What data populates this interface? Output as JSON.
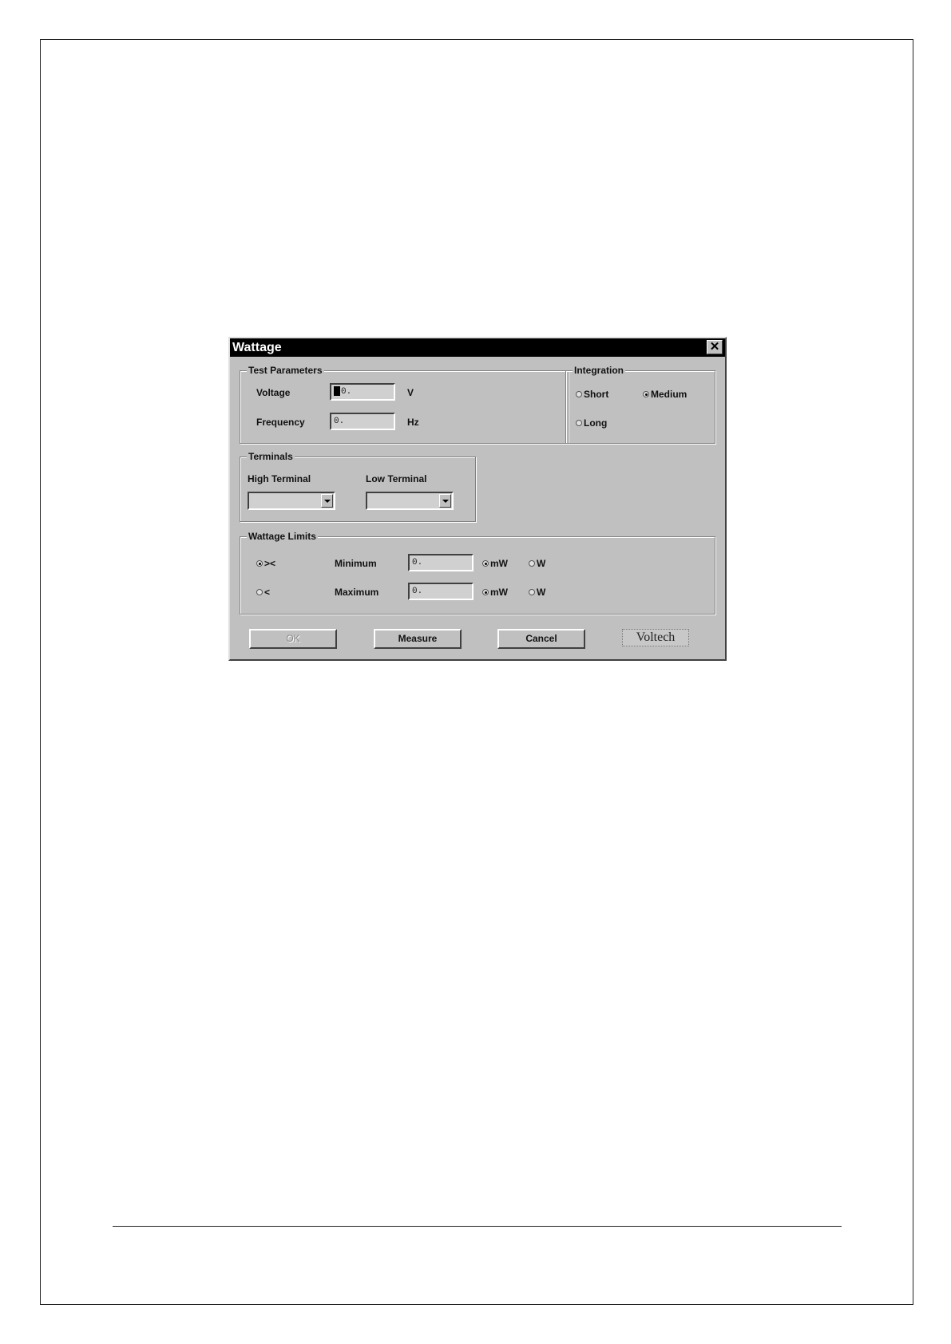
{
  "dialog": {
    "title": "Wattage",
    "close_glyph": "✕"
  },
  "test_parameters": {
    "legend": "Test Parameters",
    "voltage_label": "Voltage",
    "voltage_value": "0.",
    "voltage_unit": "V",
    "frequency_label": "Frequency",
    "frequency_value": "0.",
    "frequency_unit": "Hz"
  },
  "integration": {
    "legend": "Integration",
    "options": [
      {
        "label": "Short",
        "selected": false
      },
      {
        "label": "Medium",
        "selected": true
      },
      {
        "label": "Long",
        "selected": false
      }
    ]
  },
  "terminals": {
    "legend": "Terminals",
    "high_label": "High Terminal",
    "high_value": "",
    "low_label": "Low Terminal",
    "low_value": ""
  },
  "wattage_limits": {
    "legend": "Wattage Limits",
    "mode_options": [
      {
        "label": "><",
        "selected": true
      },
      {
        "label": "<",
        "selected": false
      }
    ],
    "minimum_label": "Minimum",
    "minimum_value": "0.",
    "maximum_label": "Maximum",
    "maximum_value": "0.",
    "min_units": [
      {
        "label": "mW",
        "selected": true
      },
      {
        "label": "W",
        "selected": false
      }
    ],
    "max_units": [
      {
        "label": "mW",
        "selected": true
      },
      {
        "label": "W",
        "selected": false
      }
    ]
  },
  "buttons": {
    "ok": "OK",
    "measure": "Measure",
    "cancel": "Cancel"
  },
  "logo_text": "Voltech",
  "icons": {
    "close": "close-icon",
    "dropdown": "chevron-down-icon"
  }
}
